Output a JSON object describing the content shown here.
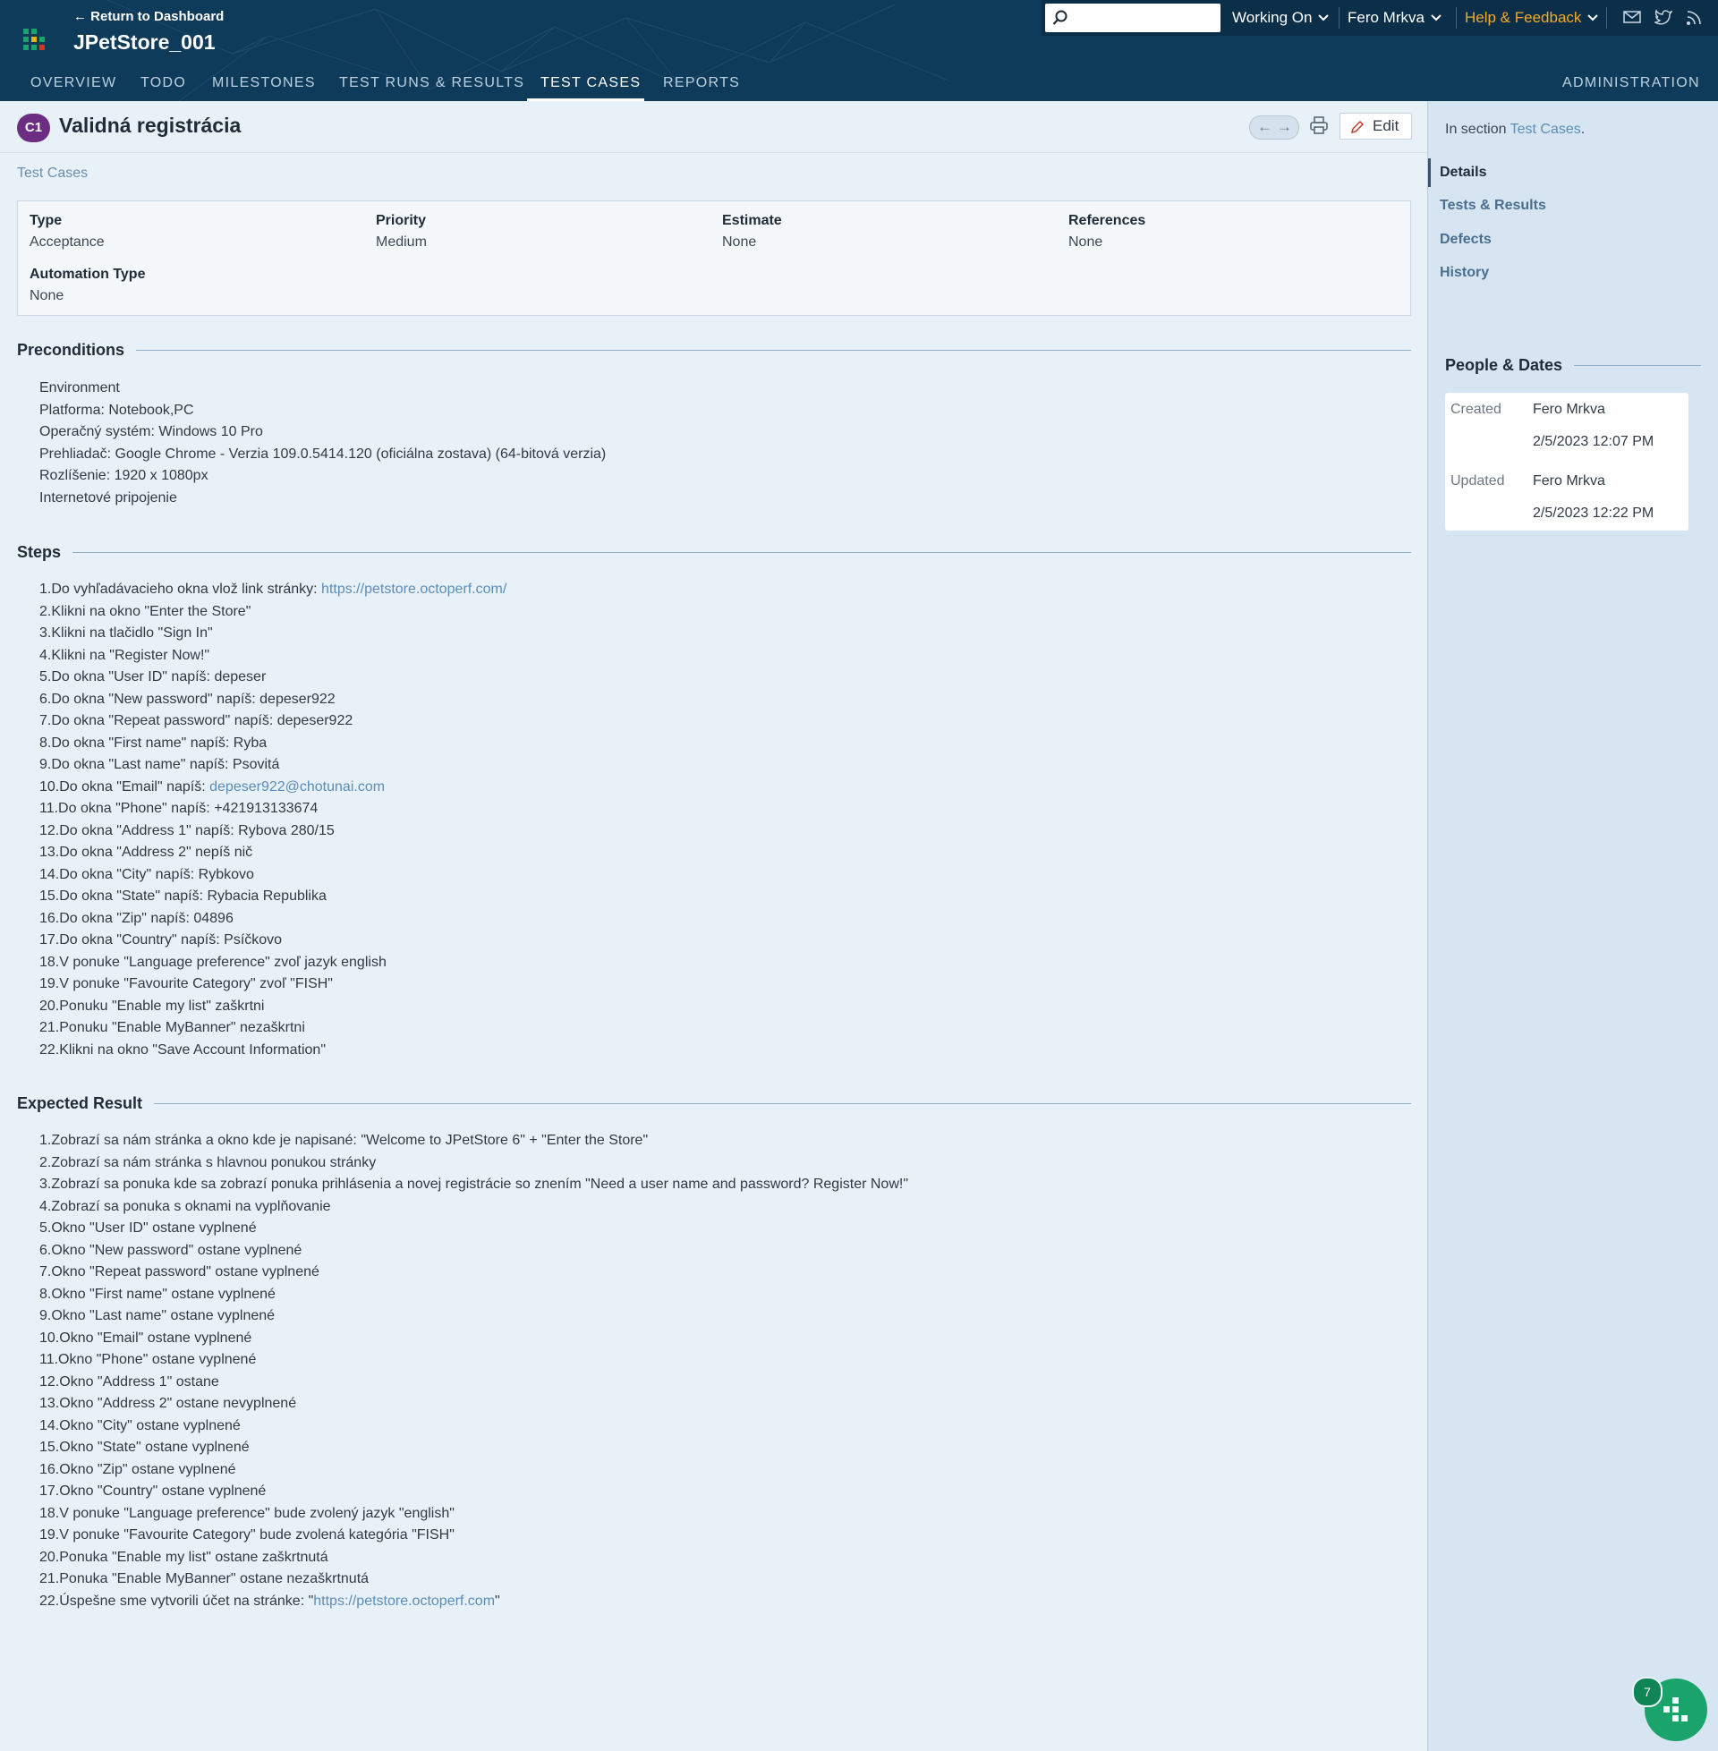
{
  "header": {
    "return_link": "← Return to Dashboard",
    "project_title": "JPetStore_001",
    "search": {
      "placeholder": ""
    },
    "working_on": "Working On",
    "user": "Fero Mrkva",
    "help": "Help & Feedback",
    "icons": [
      "mail-icon",
      "twitter-icon",
      "rss-icon"
    ]
  },
  "nav": {
    "overview": "OVERVIEW",
    "todo": "TODO",
    "milestones": "MILESTONES",
    "test_runs": "TEST RUNS & RESULTS",
    "test_cases": "TEST CASES",
    "reports": "REPORTS",
    "administration": "ADMINISTRATION",
    "active": "TEST CASES"
  },
  "case": {
    "id": "C1",
    "title": "Validná registrácia",
    "edit_label": "Edit",
    "breadcrumb": "Test Cases"
  },
  "fields": {
    "type_label": "Type",
    "type_value": "Acceptance",
    "priority_label": "Priority",
    "priority_value": "Medium",
    "estimate_label": "Estimate",
    "estimate_value": "None",
    "references_label": "References",
    "references_value": "None",
    "automation_label": "Automation Type",
    "automation_value": "None"
  },
  "preconditions": {
    "title": "Preconditions",
    "lines": [
      "Environment",
      "Platforma: Notebook,PC",
      "Operačný systém: Windows 10 Pro",
      "Prehliadač: Google Chrome - Verzia 109.0.5414.120 (oficiálna zostava) (64-bitová verzia)",
      "Rozlíšenie: 1920 x 1080px",
      "Internetové pripojenie"
    ]
  },
  "steps": {
    "title": "Steps",
    "line1_prefix": "1.Do vyhľadávacieho okna vlož link stránky: ",
    "line1_link": "https://petstore.octoperf.com/",
    "lines": [
      "2.Klikni na okno \"Enter the Store\"",
      "3.Klikni na tlačidlo \"Sign In\"",
      "4.Klikni na \"Register Now!\"",
      "5.Do okna \"User ID\" napíš: depeser",
      "6.Do okna \"New password\" napíš: depeser922",
      "7.Do okna \"Repeat password\" napíš: depeser922",
      "8.Do okna \"First name\" napíš: Ryba",
      "9.Do okna \"Last name\" napíš: Psovitá"
    ],
    "line10_prefix": "10.Do okna \"Email\" napíš: ",
    "line10_link": "depeser922@chotunai.com",
    "lines_rest": [
      "11.Do okna \"Phone\" napíš: +421913133674",
      "12.Do okna \"Address 1\" napíš: Rybova 280/15",
      "13.Do okna \"Address 2\" nepíš nič",
      "14.Do okna \"City\" napíš: Rybkovo",
      "15.Do okna \"State\" napíš: Rybacia Republika",
      "16.Do okna \"Zip\" napíš: 04896",
      "17.Do okna \"Country\" napíš: Psíčkovo",
      "18.V ponuke \"Language preference\" zvoľ jazyk english",
      "19.V ponuke \"Favourite Category\" zvoľ \"FISH\"",
      "20.Ponuku \"Enable my list\" zaškrtni",
      "21.Ponuku \"Enable MyBanner\" nezaškrtni",
      "22.Klikni na okno \"Save Account Information\""
    ]
  },
  "expected": {
    "title": "Expected Result",
    "lines": [
      "1.Zobrazí sa nám stránka a okno kde je napisané: \"Welcome to JPetStore 6\" + \"Enter the Store\"",
      "2.Zobrazí sa nám stránka s hlavnou ponukou stránky",
      "3.Zobrazí sa ponuka kde sa zobrazí ponuka prihlásenia a novej registrácie so znením \"Need a user name and password? Register Now!\"",
      "4.Zobrazí sa ponuka s oknami na vyplňovanie",
      "5.Okno \"User ID\" ostane vyplnené",
      "6.Okno \"New password\" ostane vyplnené",
      "7.Okno \"Repeat password\" ostane vyplnené",
      "8.Okno \"First name\" ostane vyplnené",
      "9.Okno \"Last name\" ostane vyplnené",
      "10.Okno \"Email\" ostane vyplnené",
      "11.Okno \"Phone\" ostane vyplnené",
      "12.Okno \"Address 1\" ostane",
      "13.Okno \"Address 2\" ostane nevyplnené",
      "14.Okno \"City\" ostane vyplnené",
      "15.Okno \"State\" ostane vyplnené",
      "16.Okno \"Zip\" ostane vyplnené",
      "17.Okno \"Country\" ostane vyplnené",
      "18.V ponuke \"Language preference\" bude zvolený jazyk \"english\"",
      "19.V ponuke \"Favourite Category\" bude zvolená kategória \"FISH\"",
      "20.Ponuka \"Enable my list\" ostane zaškrtnutá",
      "21.Ponuka \"Enable MyBanner\" ostane nezaškrtnutá"
    ],
    "line22_prefix": "22.Úspešne sme vytvorili účet na stránke: \"",
    "line22_link": "https://petstore.octoperf.com",
    "line22_suffix": "\""
  },
  "sidebar": {
    "in_section_prefix": "In section ",
    "in_section_link": "Test Cases",
    "in_section_suffix": ".",
    "tabs": [
      "Details",
      "Tests & Results",
      "Defects",
      "History"
    ],
    "people_dates_title": "People & Dates",
    "created_label": "Created",
    "created_by": "Fero Mrkva",
    "created_date": "2/5/2023 12:07 PM",
    "updated_label": "Updated",
    "updated_by": "Fero Mrkva",
    "updated_date": "2/5/2023 12:22 PM"
  },
  "fab": {
    "badge": "7"
  },
  "colors": {
    "header_bg": "#0f3b5a",
    "accent_link": "#5b8db8",
    "help_orange": "#f0a830",
    "case_badge": "#6b2e82",
    "fab": "#1aa36a"
  }
}
